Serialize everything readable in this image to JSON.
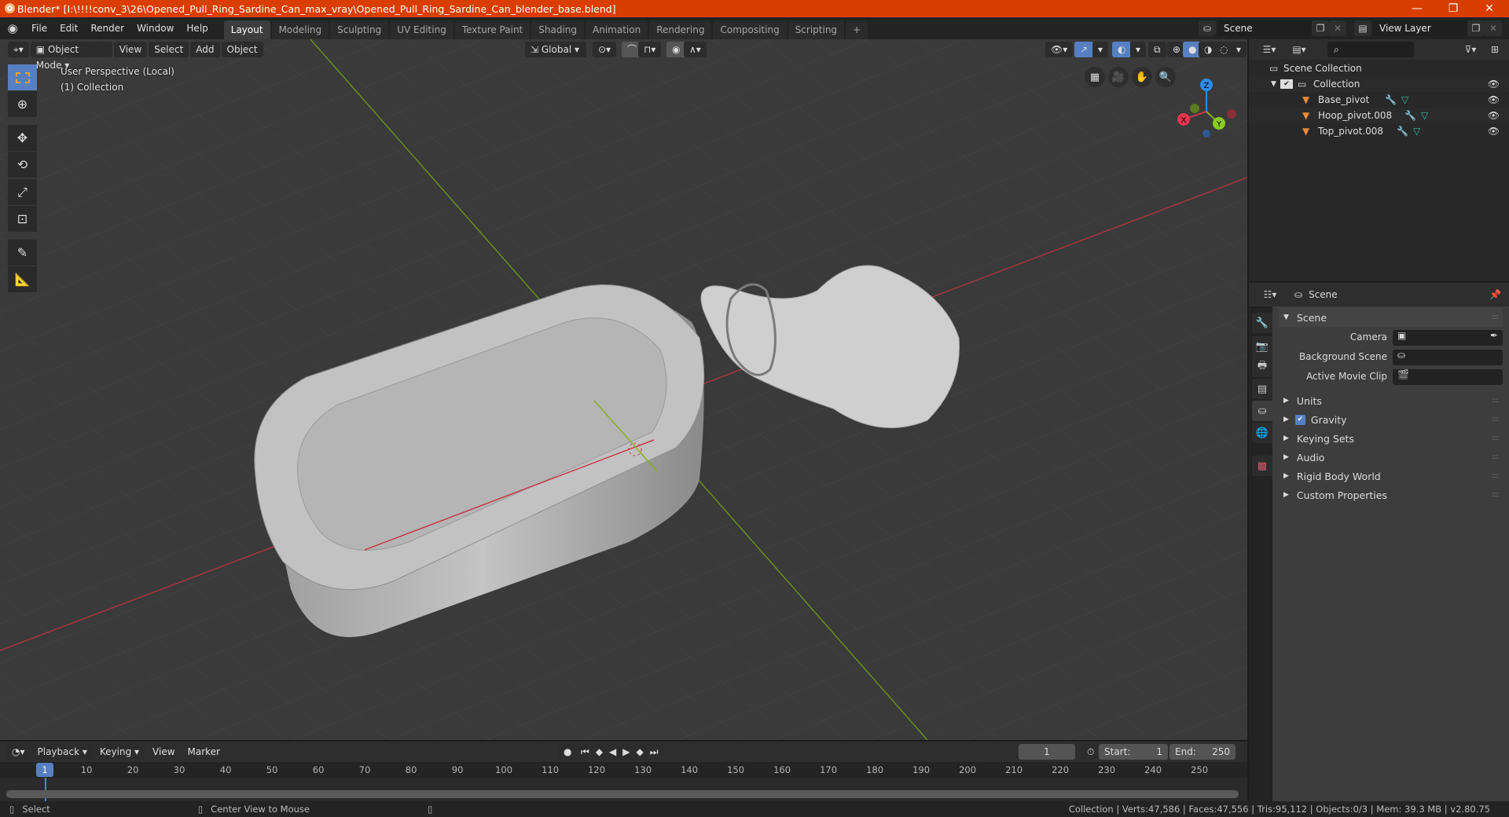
{
  "window": {
    "title": "Blender* [I:\\!!!!conv_3\\26\\Opened_Pull_Ring_Sardine_Can_max_vray\\Opened_Pull_Ring_Sardine_Can_blender_base.blend]",
    "minimize": "—",
    "restore": "❐",
    "close": "✕"
  },
  "menubar": {
    "menus": [
      "File",
      "Edit",
      "Render",
      "Window",
      "Help"
    ],
    "workspaces": [
      "Layout",
      "Modeling",
      "Sculpting",
      "UV Editing",
      "Texture Paint",
      "Shading",
      "Animation",
      "Rendering",
      "Compositing",
      "Scripting"
    ],
    "active_workspace": "Layout",
    "add_workspace": "+",
    "scene": "Scene",
    "view_layer": "View Layer"
  },
  "viewport": {
    "mode": "Object Mode",
    "menus": [
      "View",
      "Select",
      "Add",
      "Object"
    ],
    "orientation": "Global",
    "overlay_line1": "User Perspective (Local)",
    "overlay_line2": "(1) Collection",
    "gizmo": {
      "x": "X",
      "y": "Y",
      "z": "Z"
    },
    "tools": [
      "select-box",
      "cursor",
      "move",
      "rotate",
      "scale",
      "transform",
      "annotate",
      "measure"
    ],
    "colors": {
      "x_axis": "#c8394b",
      "y_axis": "#88b01c",
      "z_axis": "#2d8ceb",
      "accent": "#5680c2"
    }
  },
  "outliner": {
    "search_placeholder": "",
    "root": "Scene Collection",
    "collection": "Collection",
    "objects": [
      {
        "name": "Base_pivot"
      },
      {
        "name": "Hoop_pivot.008"
      },
      {
        "name": "Top_pivot.008"
      }
    ]
  },
  "properties": {
    "context": "Scene",
    "panel_title": "Scene",
    "fields": [
      {
        "label": "Camera",
        "value": ""
      },
      {
        "label": "Background Scene",
        "value": ""
      },
      {
        "label": "Active Movie Clip",
        "value": ""
      }
    ],
    "subpanels": [
      "Units",
      "Gravity",
      "Keying Sets",
      "Audio",
      "Rigid Body World",
      "Custom Properties"
    ],
    "gravity_checked": true
  },
  "timeline": {
    "menus": [
      "Playback",
      "Keying",
      "View",
      "Marker"
    ],
    "current_frame": "1",
    "start_label": "Start:",
    "start": "1",
    "end_label": "End:",
    "end": "250",
    "ticks": [
      "10",
      "20",
      "30",
      "40",
      "50",
      "60",
      "70",
      "80",
      "90",
      "100",
      "110",
      "120",
      "130",
      "140",
      "150",
      "160",
      "170",
      "180",
      "190",
      "200",
      "210",
      "220",
      "230",
      "240",
      "250"
    ]
  },
  "statusbar": {
    "left_action": "Select",
    "middle_action": "Center View to Mouse",
    "stats": "Collection | Verts:47,586 | Faces:47,556 | Tris:95,112 | Objects:0/3 | Mem: 39.3 MB | v2.80.75"
  }
}
